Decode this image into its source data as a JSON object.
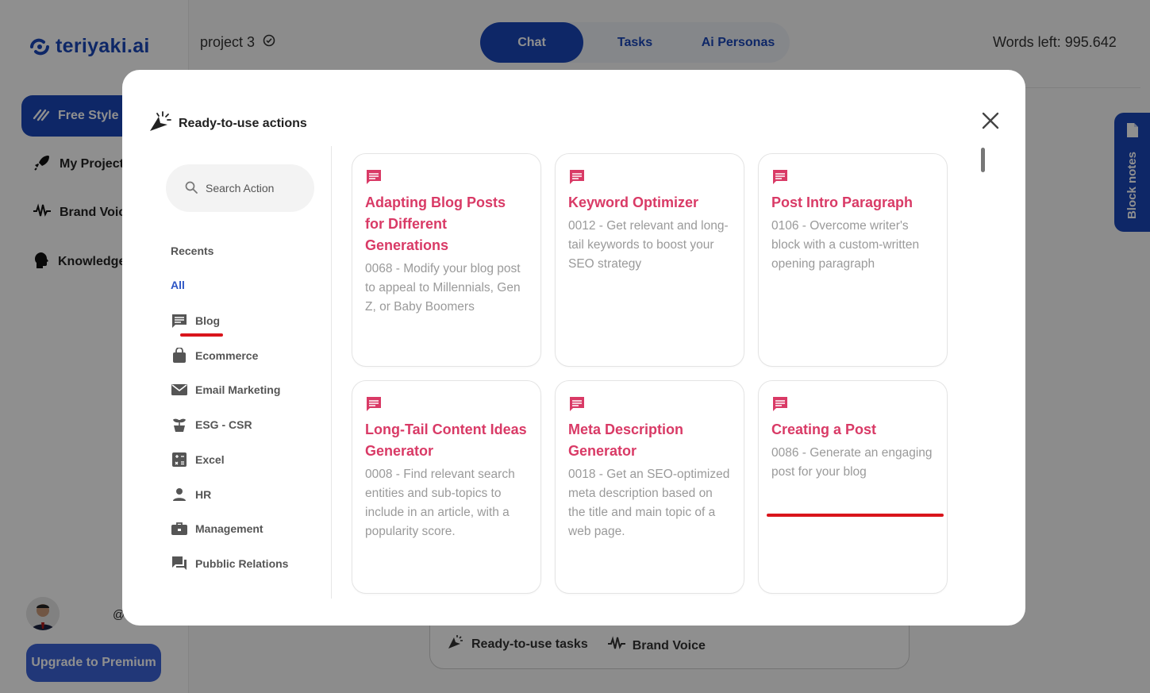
{
  "app": {
    "logo": "teriyaki.ai",
    "project_name": "project 3",
    "top_tabs": [
      "Chat",
      "Tasks",
      "Ai Personas"
    ],
    "words_left": "Words left: 995.642",
    "sidebar": {
      "items": [
        {
          "label": "Free Style",
          "icon": "free-style-icon"
        },
        {
          "label": "My Projects",
          "icon": "rocket-icon"
        },
        {
          "label": "Brand Voice",
          "icon": "waveform-icon"
        },
        {
          "label": "Knowledge",
          "icon": "head-icon"
        }
      ],
      "at_handle": "@",
      "upgrade_label": "Upgrade to Premium"
    },
    "block_notes_label": "Block notes",
    "composer_chips": [
      "Ready-to-use tasks",
      "Brand Voice"
    ]
  },
  "modal": {
    "title": "Ready-to-use actions",
    "search_placeholder": "Search Action",
    "recents_label": "Recents",
    "all_label": "All",
    "categories": [
      {
        "label": "Blog",
        "icon": "comment-icon"
      },
      {
        "label": "Ecommerce",
        "icon": "shopping-bag-icon"
      },
      {
        "label": "Email Marketing",
        "icon": "mail-icon"
      },
      {
        "label": "ESG - CSR",
        "icon": "plant-icon"
      },
      {
        "label": "Excel",
        "icon": "calculator-icon"
      },
      {
        "label": "HR",
        "icon": "person-icon"
      },
      {
        "label": "Management",
        "icon": "briefcase-icon"
      },
      {
        "label": "Pubblic Relations",
        "icon": "chat-bubbles-icon"
      }
    ],
    "cards": [
      {
        "title": "Adapting Blog Posts for Different Generations",
        "desc": "0068 - Modify your blog post to appeal to Millennials, Gen Z, or Baby Boomers"
      },
      {
        "title": "Keyword Optimizer",
        "desc": "0012 - Get relevant and long-tail keywords to boost your SEO strategy"
      },
      {
        "title": "Post Intro Paragraph",
        "desc": "0106 - Overcome writer's block with a custom-written opening paragraph"
      },
      {
        "title": "Long-Tail Content Ideas Generator",
        "desc": "0008 - Find relevant search entities and sub-topics to include in an article, with a popularity score."
      },
      {
        "title": "Meta Description Generator",
        "desc": "0018 - Get an SEO-optimized meta description based on the title and main topic of a web page."
      },
      {
        "title": "Creating a Post",
        "desc": "0086 - Generate an engaging post for your blog"
      }
    ]
  },
  "colors": {
    "brand": "#1a47b8",
    "card_title": "#d93a66",
    "annotation_red": "#d9151c"
  }
}
